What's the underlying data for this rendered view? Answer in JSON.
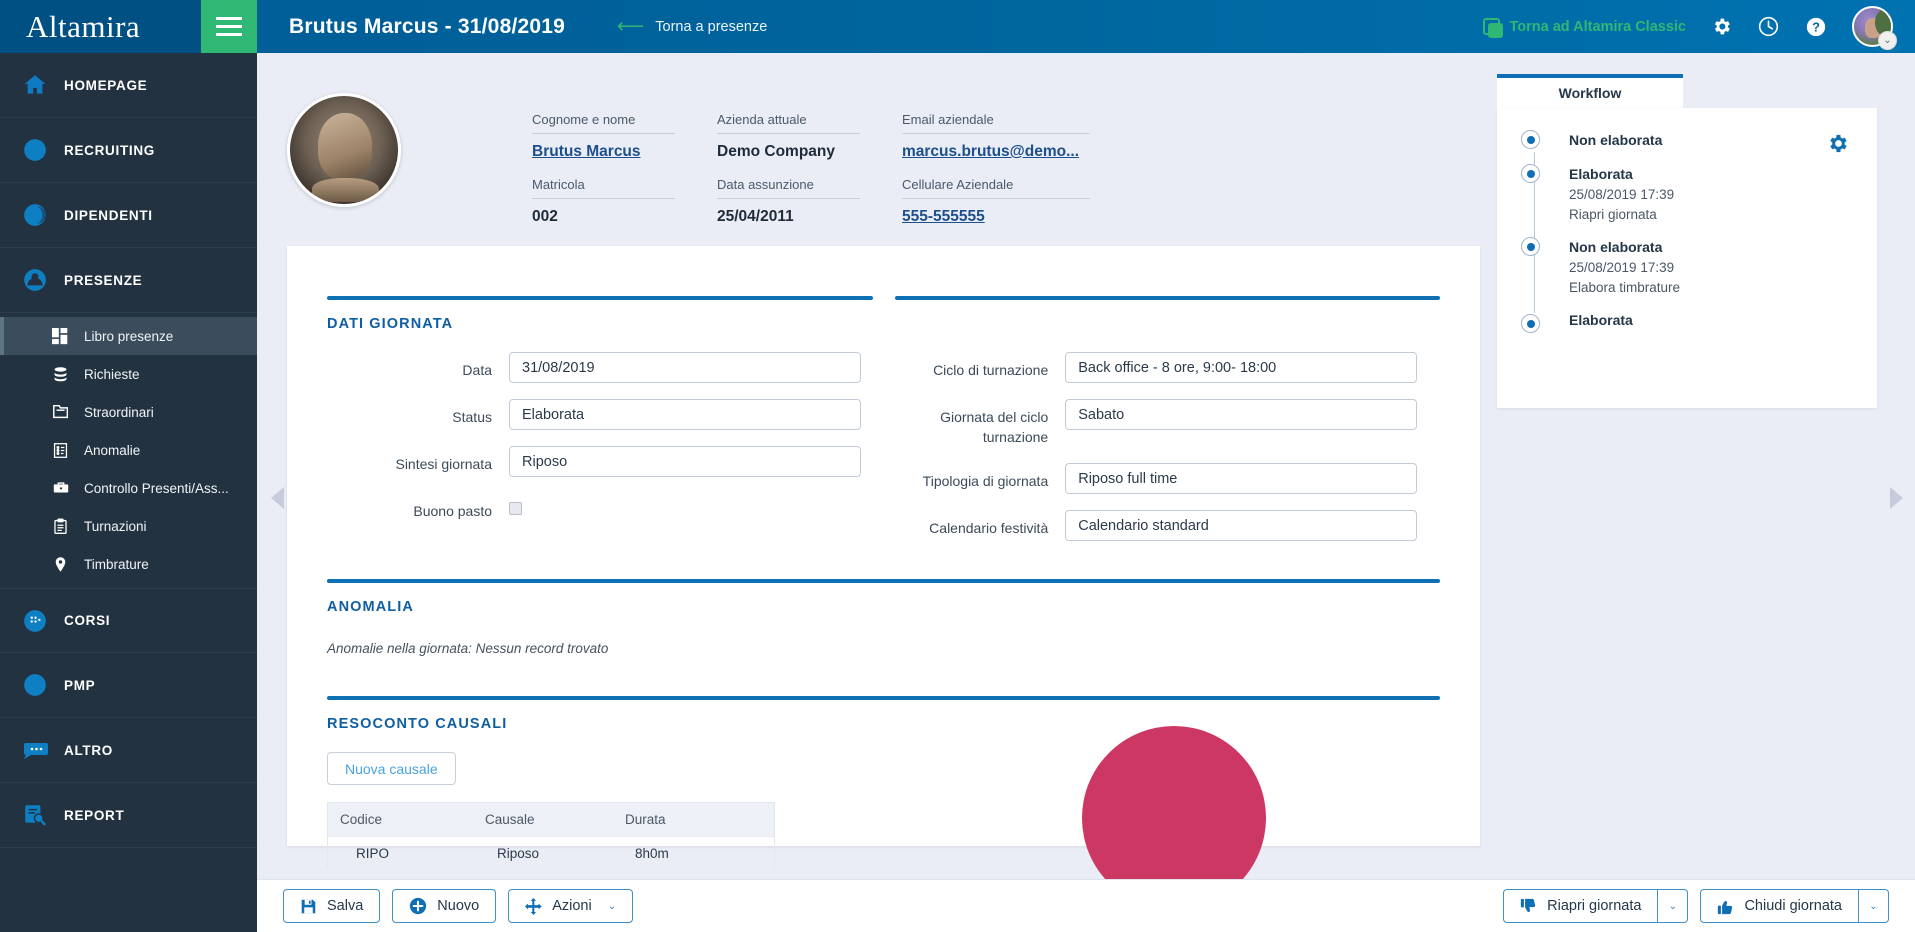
{
  "topbar": {
    "brand": "Altamira",
    "menu_icon": "hamburger-icon",
    "page_title": "Brutus Marcus - 31/08/2019",
    "back_label": "Torna a presenze",
    "classic_label": "Torna ad Altamira Classic",
    "gear_icon": "gear-icon",
    "clock_icon": "clock-icon",
    "help_icon": "help-icon",
    "avatar_caret": "⌄"
  },
  "sidebar": {
    "items": [
      {
        "label": "HOMEPAGE",
        "icon": "home-icon"
      },
      {
        "label": "RECRUITING",
        "icon": "recruiting-icon"
      },
      {
        "label": "DIPENDENTI",
        "icon": "employees-icon"
      },
      {
        "label": "PRESENZE",
        "icon": "attendance-icon"
      },
      {
        "label": "CORSI",
        "icon": "courses-icon"
      },
      {
        "label": "PMP",
        "icon": "pmp-icon"
      },
      {
        "label": "ALTRO",
        "icon": "other-icon"
      },
      {
        "label": "REPORT",
        "icon": "report-icon"
      }
    ],
    "presenze_sub": [
      {
        "label": "Libro presenze",
        "icon": "grid-icon",
        "selected": true
      },
      {
        "label": "Richieste",
        "icon": "database-icon",
        "selected": false
      },
      {
        "label": "Straordinari",
        "icon": "folder-icon",
        "selected": false
      },
      {
        "label": "Anomalie",
        "icon": "document-icon",
        "selected": false
      },
      {
        "label": "Controllo Presenti/Ass...",
        "icon": "briefcase-icon",
        "selected": false
      },
      {
        "label": "Turnazioni",
        "icon": "clipboard-icon",
        "selected": false
      },
      {
        "label": "Timbrature",
        "icon": "pin-icon",
        "selected": false
      }
    ]
  },
  "employee": {
    "photo_alt": "employee-photo",
    "fields": [
      {
        "label": "Cognome e nome",
        "value": "Brutus Marcus",
        "link": true
      },
      {
        "label": "Matricola",
        "value": "002",
        "link": false
      },
      {
        "label": "Azienda attuale",
        "value": "Demo Company",
        "link": false
      },
      {
        "label": "Data assunzione",
        "value": "25/04/2011",
        "link": false
      },
      {
        "label": "Email aziendale",
        "value": "marcus.brutus@demo...",
        "link": true
      },
      {
        "label": "Cellulare Aziendale",
        "value": "555-555555",
        "link": true
      }
    ]
  },
  "dati_giornata": {
    "title": "DATI GIORNATA",
    "left_fields": [
      {
        "label": "Data",
        "value": "31/08/2019",
        "type": "text"
      },
      {
        "label": "Status",
        "value": "Elaborata",
        "type": "text"
      },
      {
        "label": "Sintesi giornata",
        "value": "Riposo",
        "type": "text"
      },
      {
        "label": "Buono pasto",
        "value": "",
        "type": "checkbox",
        "checked": false
      }
    ],
    "right_fields": [
      {
        "label": "Ciclo di turnazione",
        "value": "Back office - 8 ore, 9:00- 18:00",
        "type": "text"
      },
      {
        "label": "Giornata del ciclo turnazione",
        "value": "Sabato",
        "type": "text"
      },
      {
        "label": "Tipologia di giornata",
        "value": "Riposo full time",
        "type": "text"
      },
      {
        "label": "Calendario festività",
        "value": "Calendario standard",
        "type": "text"
      }
    ]
  },
  "anomalia": {
    "title": "ANOMALIA",
    "note": "Anomalie nella giornata: Nessun record trovato"
  },
  "resoconto": {
    "title": "RESOCONTO CAUSALI",
    "new_button": "Nuova causale",
    "columns": [
      "Codice",
      "Causale",
      "Durata"
    ],
    "rows": [
      [
        "RIPO",
        "Riposo",
        "8h0m"
      ]
    ]
  },
  "workflow": {
    "tab_label": "Workflow",
    "gear_icon": "gear-icon",
    "steps": [
      {
        "state": "Non elaborata",
        "timestamp": "",
        "action": ""
      },
      {
        "state": "Elaborata",
        "timestamp": "25/08/2019 17:39",
        "action": "Riapri giornata"
      },
      {
        "state": "Non elaborata",
        "timestamp": "25/08/2019 17:39",
        "action": "Elabora timbrature"
      },
      {
        "state": "Elaborata",
        "timestamp": "",
        "action": ""
      }
    ]
  },
  "bottombar": {
    "save_label": "Salva",
    "new_label": "Nuovo",
    "actions_label": "Azioni",
    "reopen_label": "Riapri giornata",
    "close_label": "Chiudi giornata",
    "caret": "⌄"
  },
  "nav": {
    "prev_icon": "chevron-left-icon",
    "next_icon": "chevron-right-icon"
  },
  "colors": {
    "brand_blue": "#00669e",
    "accent_green": "#2eb873",
    "section_blue": "#0f6fb5",
    "sidebar_dark": "#233240",
    "pink": "#cc3763"
  }
}
